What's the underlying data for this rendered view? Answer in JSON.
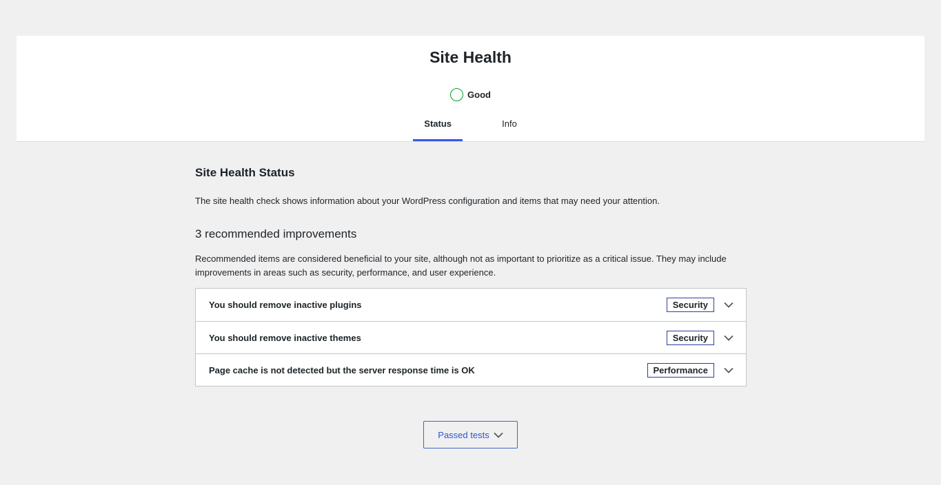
{
  "header": {
    "title": "Site Health",
    "status_label": "Good",
    "status_color": "#00a32a"
  },
  "tabs": [
    {
      "label": "Status",
      "active": true
    },
    {
      "label": "Info",
      "active": false
    }
  ],
  "accent_color": "#3858e9",
  "status_section": {
    "title": "Site Health Status",
    "description": "The site health check shows information about your WordPress configuration and items that may need your attention."
  },
  "improvements": {
    "title": "3 recommended improvements",
    "description": "Recommended items are considered beneficial to your site, although not as important to prioritize as a critical issue. They may include improvements in areas such as security, performance, and user experience.",
    "items": [
      {
        "title": "You should remove inactive plugins",
        "badge": "Security",
        "icon": "chevron-down-icon"
      },
      {
        "title": "You should remove inactive themes",
        "badge": "Security",
        "icon": "chevron-down-icon"
      },
      {
        "title": "Page cache is not detected but the server response time is OK",
        "badge": "Performance",
        "icon": "chevron-down-icon"
      }
    ]
  },
  "passed_tests": {
    "label": "Passed tests",
    "icon": "chevron-down-icon"
  }
}
